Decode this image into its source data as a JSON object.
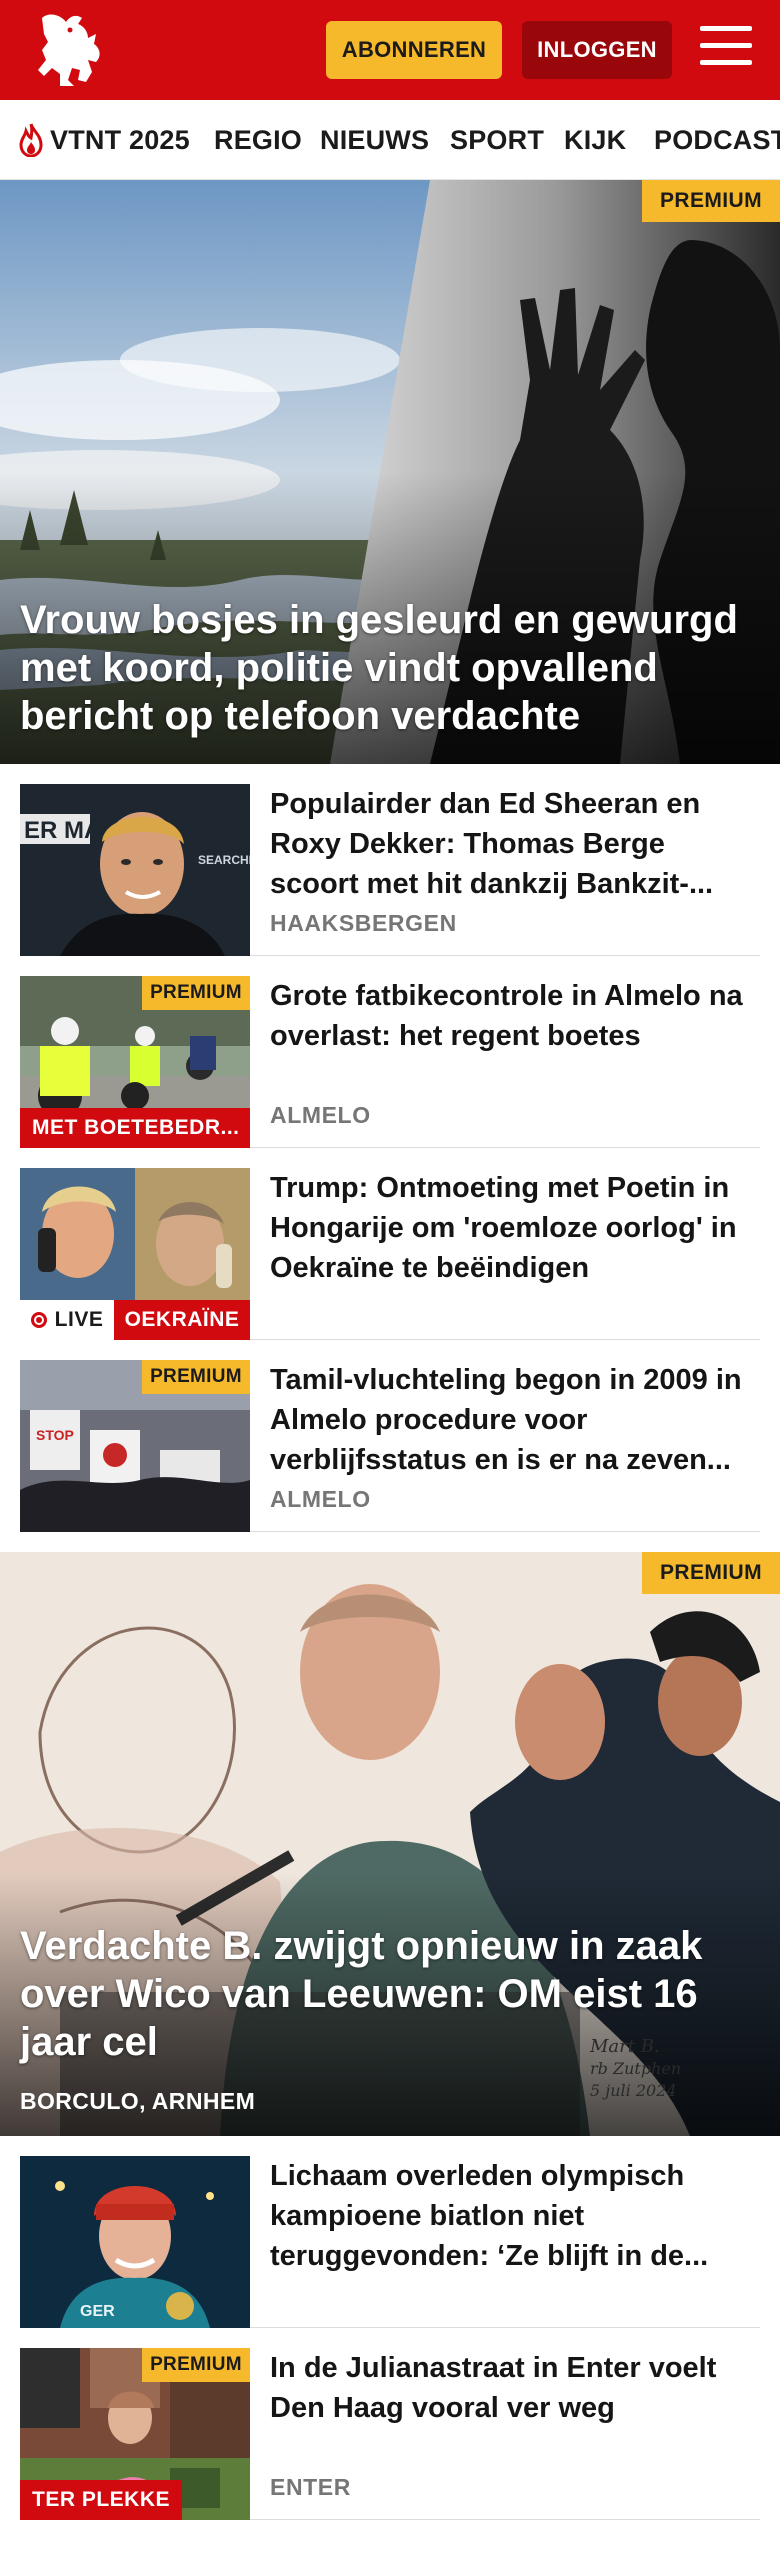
{
  "header": {
    "subscribe_label": "ABONNEREN",
    "login_label": "INLOGGEN"
  },
  "nav": {
    "items": [
      {
        "label": "VTNT 2025",
        "icon": "flame-icon"
      },
      {
        "label": "REGIO"
      },
      {
        "label": "NIEUWS"
      },
      {
        "label": "SPORT"
      },
      {
        "label": "KIJK"
      },
      {
        "label": "PODCAST"
      }
    ]
  },
  "hero1": {
    "badge": "PREMIUM",
    "title": "Vrouw bosjes in gesleurd en gewurgd met koord, politie vindt opvallend bericht op telefoon verdachte"
  },
  "articles": [
    {
      "title": "Populairder dan Ed Sheeran en Roxy Dekker: Thomas Berge scoort met hit dankzij Bankzit-...",
      "location": "HAAKSBERGEN"
    },
    {
      "title": "Grote fatbikecontrole in Almelo na overlast: het regent boetes",
      "location": "ALMELO",
      "badge": "PREMIUM",
      "tag": "MET BOETEBEDR..."
    },
    {
      "title": "Trump: Ontmoeting met Poetin in Hongarije om 'roemloze oorlog' in Oekraïne te beëindigen",
      "live": "LIVE",
      "tag": "OEKRAÏNE"
    },
    {
      "title": "Tamil-vluchteling begon in 2009 in Almelo procedure voor verblijfsstatus en is er na zeven...",
      "location": "ALMELO",
      "badge": "PREMIUM"
    }
  ],
  "hero2": {
    "badge": "PREMIUM",
    "title": "Verdachte B. zwijgt opnieuw in zaak over Wico van Leeuwen: OM eist 16 jaar cel",
    "location": "BORCULO, ARNHEM",
    "sketch_signature": "Mart B. rb Zutphen 5 juli 2024"
  },
  "articles2": [
    {
      "title": "Lichaam overleden olympisch kampioene biatlon niet teruggevonden: ‘Ze blijft in de..."
    },
    {
      "title": "In de Julianastraat in Enter voelt Den Haag vooral ver weg",
      "location": "ENTER",
      "badge": "PREMIUM",
      "tag": "TER PLEKKE"
    }
  ],
  "colors": {
    "brand_red": "#d10a10",
    "premium_yellow": "#f7b92c",
    "login_dark_red": "#99070b"
  }
}
